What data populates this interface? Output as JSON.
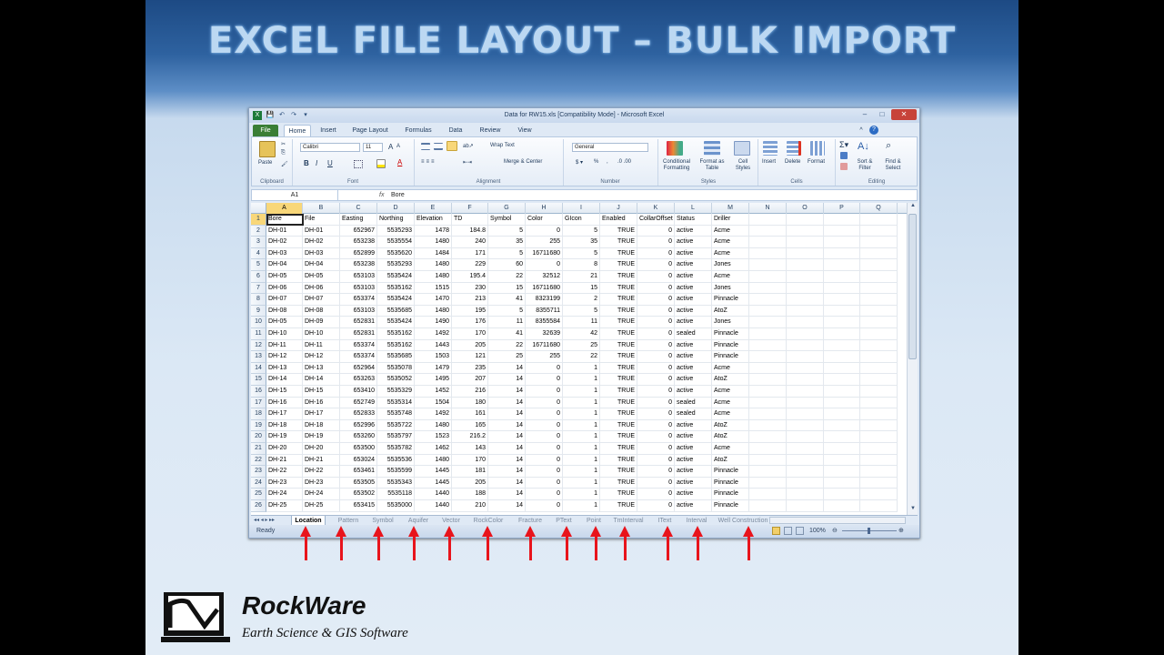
{
  "slide": {
    "title": "EXCEL FILE LAYOUT – BULK IMPORT"
  },
  "window": {
    "title": "Data for RW15.xls  [Compatibility Mode] - Microsoft Excel",
    "qat": [
      "X",
      "💾",
      "↶",
      "↷",
      "▾"
    ]
  },
  "tabs": [
    "File",
    "Home",
    "Insert",
    "Page Layout",
    "Formulas",
    "Data",
    "Review",
    "View"
  ],
  "ribbon": {
    "paste": "Paste",
    "font_name": "Calibri",
    "font_size": "11",
    "wrap_text": "Wrap Text",
    "merge_center": "Merge & Center",
    "number_format": "General",
    "conditional": "Conditional Formatting",
    "format_table": "Format as Table",
    "cell_styles": "Cell Styles",
    "insert": "Insert",
    "delete": "Delete",
    "format": "Format",
    "sort_filter": "Sort & Filter",
    "find_select": "Find & Select",
    "groups": [
      "Clipboard",
      "Font",
      "Alignment",
      "Number",
      "Styles",
      "Cells",
      "Editing"
    ]
  },
  "formula_bar": {
    "name_box": "A1",
    "fx": "fx",
    "value": "Bore"
  },
  "columns": [
    "A",
    "B",
    "C",
    "D",
    "E",
    "F",
    "G",
    "H",
    "I",
    "J",
    "K",
    "L",
    "M",
    "N",
    "O",
    "P",
    "Q"
  ],
  "headers": [
    "Bore",
    "File",
    "Easting",
    "Northing",
    "Elevation",
    "TD",
    "Symbol",
    "Color",
    "GIcon",
    "Enabled",
    "CollarOffset",
    "Status",
    "Driller"
  ],
  "rows": [
    [
      "DH-01",
      "DH-01",
      "652967",
      "5535293",
      "1478",
      "184.8",
      "5",
      "0",
      "5",
      "TRUE",
      "0",
      "active",
      "Acme"
    ],
    [
      "DH-02",
      "DH-02",
      "653238",
      "5535554",
      "1480",
      "240",
      "35",
      "255",
      "35",
      "TRUE",
      "0",
      "active",
      "Acme"
    ],
    [
      "DH-03",
      "DH-03",
      "652899",
      "5535620",
      "1484",
      "171",
      "5",
      "16711680",
      "5",
      "TRUE",
      "0",
      "active",
      "Acme"
    ],
    [
      "DH-04",
      "DH-04",
      "653238",
      "5535293",
      "1480",
      "229",
      "60",
      "0",
      "8",
      "TRUE",
      "0",
      "active",
      "Jones"
    ],
    [
      "DH-05",
      "DH-05",
      "653103",
      "5535424",
      "1480",
      "195.4",
      "22",
      "32512",
      "21",
      "TRUE",
      "0",
      "active",
      "Acme"
    ],
    [
      "DH-06",
      "DH-06",
      "653103",
      "5535162",
      "1515",
      "230",
      "15",
      "16711680",
      "15",
      "TRUE",
      "0",
      "active",
      "Jones"
    ],
    [
      "DH-07",
      "DH-07",
      "653374",
      "5535424",
      "1470",
      "213",
      "41",
      "8323199",
      "2",
      "TRUE",
      "0",
      "active",
      "Pinnacle"
    ],
    [
      "DH-08",
      "DH-08",
      "653103",
      "5535685",
      "1480",
      "195",
      "5",
      "8355711",
      "5",
      "TRUE",
      "0",
      "active",
      "AtoZ"
    ],
    [
      "DH-05",
      "DH-09",
      "652831",
      "5535424",
      "1490",
      "176",
      "11",
      "8355584",
      "11",
      "TRUE",
      "0",
      "active",
      "Jones"
    ],
    [
      "DH-10",
      "DH-10",
      "652831",
      "5535162",
      "1492",
      "170",
      "41",
      "32639",
      "42",
      "TRUE",
      "0",
      "sealed",
      "Pinnacle"
    ],
    [
      "DH-11",
      "DH-11",
      "653374",
      "5535162",
      "1443",
      "205",
      "22",
      "16711680",
      "25",
      "TRUE",
      "0",
      "active",
      "Pinnacle"
    ],
    [
      "DH-12",
      "DH-12",
      "653374",
      "5535685",
      "1503",
      "121",
      "25",
      "255",
      "22",
      "TRUE",
      "0",
      "active",
      "Pinnacle"
    ],
    [
      "DH-13",
      "DH-13",
      "652964",
      "5535078",
      "1479",
      "235",
      "14",
      "0",
      "1",
      "TRUE",
      "0",
      "active",
      "Acme"
    ],
    [
      "DH-14",
      "DH-14",
      "653263",
      "5535052",
      "1495",
      "207",
      "14",
      "0",
      "1",
      "TRUE",
      "0",
      "active",
      "AtoZ"
    ],
    [
      "DH-15",
      "DH-15",
      "653410",
      "5535329",
      "1452",
      "216",
      "14",
      "0",
      "1",
      "TRUE",
      "0",
      "active",
      "Acme"
    ],
    [
      "DH-16",
      "DH-16",
      "652749",
      "5535314",
      "1504",
      "180",
      "14",
      "0",
      "1",
      "TRUE",
      "0",
      "sealed",
      "Acme"
    ],
    [
      "DH-17",
      "DH-17",
      "652833",
      "5535748",
      "1492",
      "161",
      "14",
      "0",
      "1",
      "TRUE",
      "0",
      "sealed",
      "Acme"
    ],
    [
      "DH-18",
      "DH-18",
      "652996",
      "5535722",
      "1480",
      "165",
      "14",
      "0",
      "1",
      "TRUE",
      "0",
      "active",
      "AtoZ"
    ],
    [
      "DH-19",
      "DH-19",
      "653260",
      "5535797",
      "1523",
      "216.2",
      "14",
      "0",
      "1",
      "TRUE",
      "0",
      "active",
      "AtoZ"
    ],
    [
      "DH-20",
      "DH-20",
      "653500",
      "5535782",
      "1462",
      "143",
      "14",
      "0",
      "1",
      "TRUE",
      "0",
      "active",
      "Acme"
    ],
    [
      "DH-21",
      "DH-21",
      "653024",
      "5535536",
      "1480",
      "170",
      "14",
      "0",
      "1",
      "TRUE",
      "0",
      "active",
      "AtoZ"
    ],
    [
      "DH-22",
      "DH-22",
      "653461",
      "5535599",
      "1445",
      "181",
      "14",
      "0",
      "1",
      "TRUE",
      "0",
      "active",
      "Pinnacle"
    ],
    [
      "DH-23",
      "DH-23",
      "653505",
      "5535343",
      "1445",
      "205",
      "14",
      "0",
      "1",
      "TRUE",
      "0",
      "active",
      "Pinnacle"
    ],
    [
      "DH-24",
      "DH-24",
      "653502",
      "5535118",
      "1440",
      "188",
      "14",
      "0",
      "1",
      "TRUE",
      "0",
      "active",
      "Pinnacle"
    ],
    [
      "DH-25",
      "DH-25",
      "653415",
      "5535000",
      "1440",
      "210",
      "14",
      "0",
      "1",
      "TRUE",
      "0",
      "active",
      "Pinnacle"
    ]
  ],
  "sheets": [
    "Location",
    "Pattern",
    "Symbol",
    "Aquifer",
    "Vector",
    "RockColor",
    "Fracture",
    "PText",
    "Point",
    "TmInterval",
    "IText",
    "Interval",
    "Well Construction"
  ],
  "status": {
    "ready": "Ready",
    "zoom": "100%"
  },
  "brand": {
    "name": "RockWare",
    "tagline": "Earth Science & GIS Software"
  },
  "colors": {
    "arrow": "#e8141c",
    "file_tab": "#3a7e35",
    "title_glow": "#bcd8f2"
  }
}
